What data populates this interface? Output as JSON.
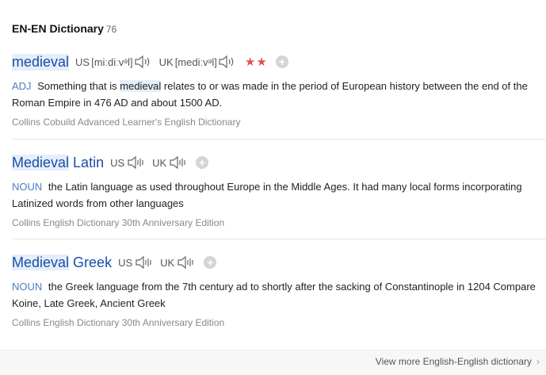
{
  "header": {
    "title": "EN-EN Dictionary",
    "count": "76"
  },
  "entries": [
    {
      "headword": "medieval",
      "us_label": "US",
      "us_ipa": "[miːdiːvᵊl]",
      "uk_label": "UK",
      "uk_ipa": "[mediːvᵊl]",
      "stars": "★★",
      "add": "+",
      "pos": "ADJ",
      "def_before": "Something that is",
      "def_highlight": "medieval",
      "def_after": "relates to or was made in the period of European history between the end of the Roman Empire in 476 AD and about 1500 AD.",
      "source": "Collins Cobuild Advanced Learner's English Dictionary"
    },
    {
      "headword_highlight": "Medieval",
      "headword_rest": " Latin",
      "us_label": "US",
      "uk_label": "UK",
      "add": "+",
      "pos": "NOUN",
      "definition": "the Latin language as used throughout Europe in the Middle Ages. It had many local forms incorporating Latinized words from other languages",
      "source": "Collins English Dictionary 30th Anniversary Edition"
    },
    {
      "headword_highlight": "Medieval",
      "headword_rest": " Greek",
      "us_label": "US",
      "uk_label": "UK",
      "add": "+",
      "pos": "NOUN",
      "definition": "the Greek language from the 7th century ad to shortly after the sacking of Constantinople in 1204 Compare Koine, Late Greek, Ancient Greek",
      "source": "Collins English Dictionary 30th Anniversary Edition"
    }
  ],
  "footer": {
    "more_label": "View more English-English dictionary",
    "chevron": "›"
  },
  "colors": {
    "headword": "#1a4ea8",
    "pos": "#4d7dc4",
    "stars": "#d9534f",
    "highlight": "#e5eef9"
  },
  "icons": {
    "pronounce": "speaker-icon",
    "add": "plus-circle-icon",
    "more": "chevron-right-icon"
  }
}
